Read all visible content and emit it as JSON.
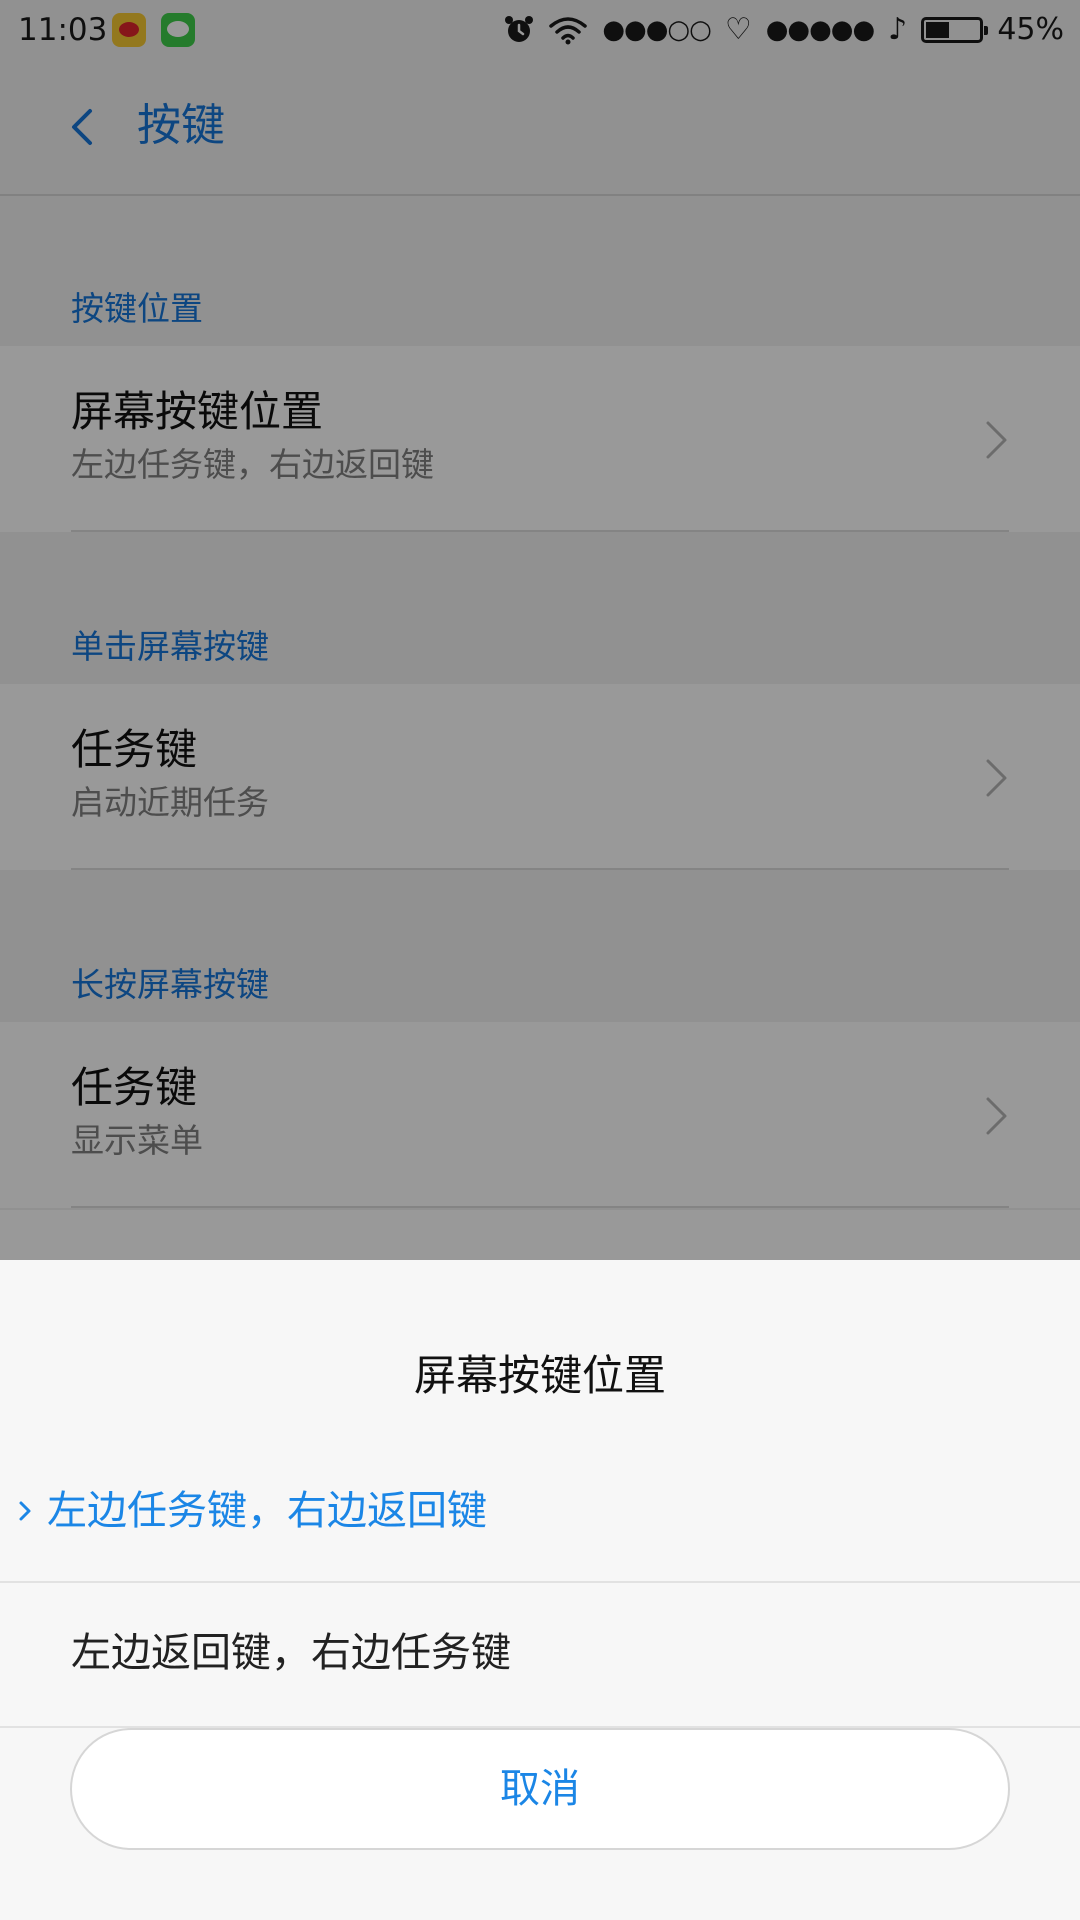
{
  "status_bar": {
    "time": "11:03",
    "app_icons": [
      "weibo-icon",
      "messages-icon"
    ],
    "alarm_icon": "alarm-clock-icon",
    "wifi_icon": "wifi-icon",
    "signal_1": "●●●○○",
    "heart": "♡",
    "signal_2": "●●●●●",
    "music_note": "♪",
    "battery_level": 0.45,
    "battery_text": "45%"
  },
  "header": {
    "back_icon": "chevron-left-icon",
    "title": "按键"
  },
  "sections": [
    {
      "header": "按键位置",
      "rows": [
        {
          "title": "屏幕按键位置",
          "subtitle": "左边任务键，右边返回键"
        }
      ]
    },
    {
      "header": "单击屏幕按键",
      "rows": [
        {
          "title": "任务键",
          "subtitle": "启动近期任务"
        }
      ]
    },
    {
      "header": "长按屏幕按键",
      "rows": [
        {
          "title": "任务键",
          "subtitle": "显示菜单"
        }
      ]
    }
  ],
  "dialog": {
    "title": "屏幕按键位置",
    "options": [
      {
        "label": "左边任务键，右边返回键",
        "selected": true
      },
      {
        "label": "左边返回键，右边任务键",
        "selected": false
      }
    ],
    "cancel_label": "取消"
  },
  "colors": {
    "accent": "#1b86e6",
    "section_header": "#1675d8",
    "overlay": "rgba(0,0,0,0.40)"
  }
}
